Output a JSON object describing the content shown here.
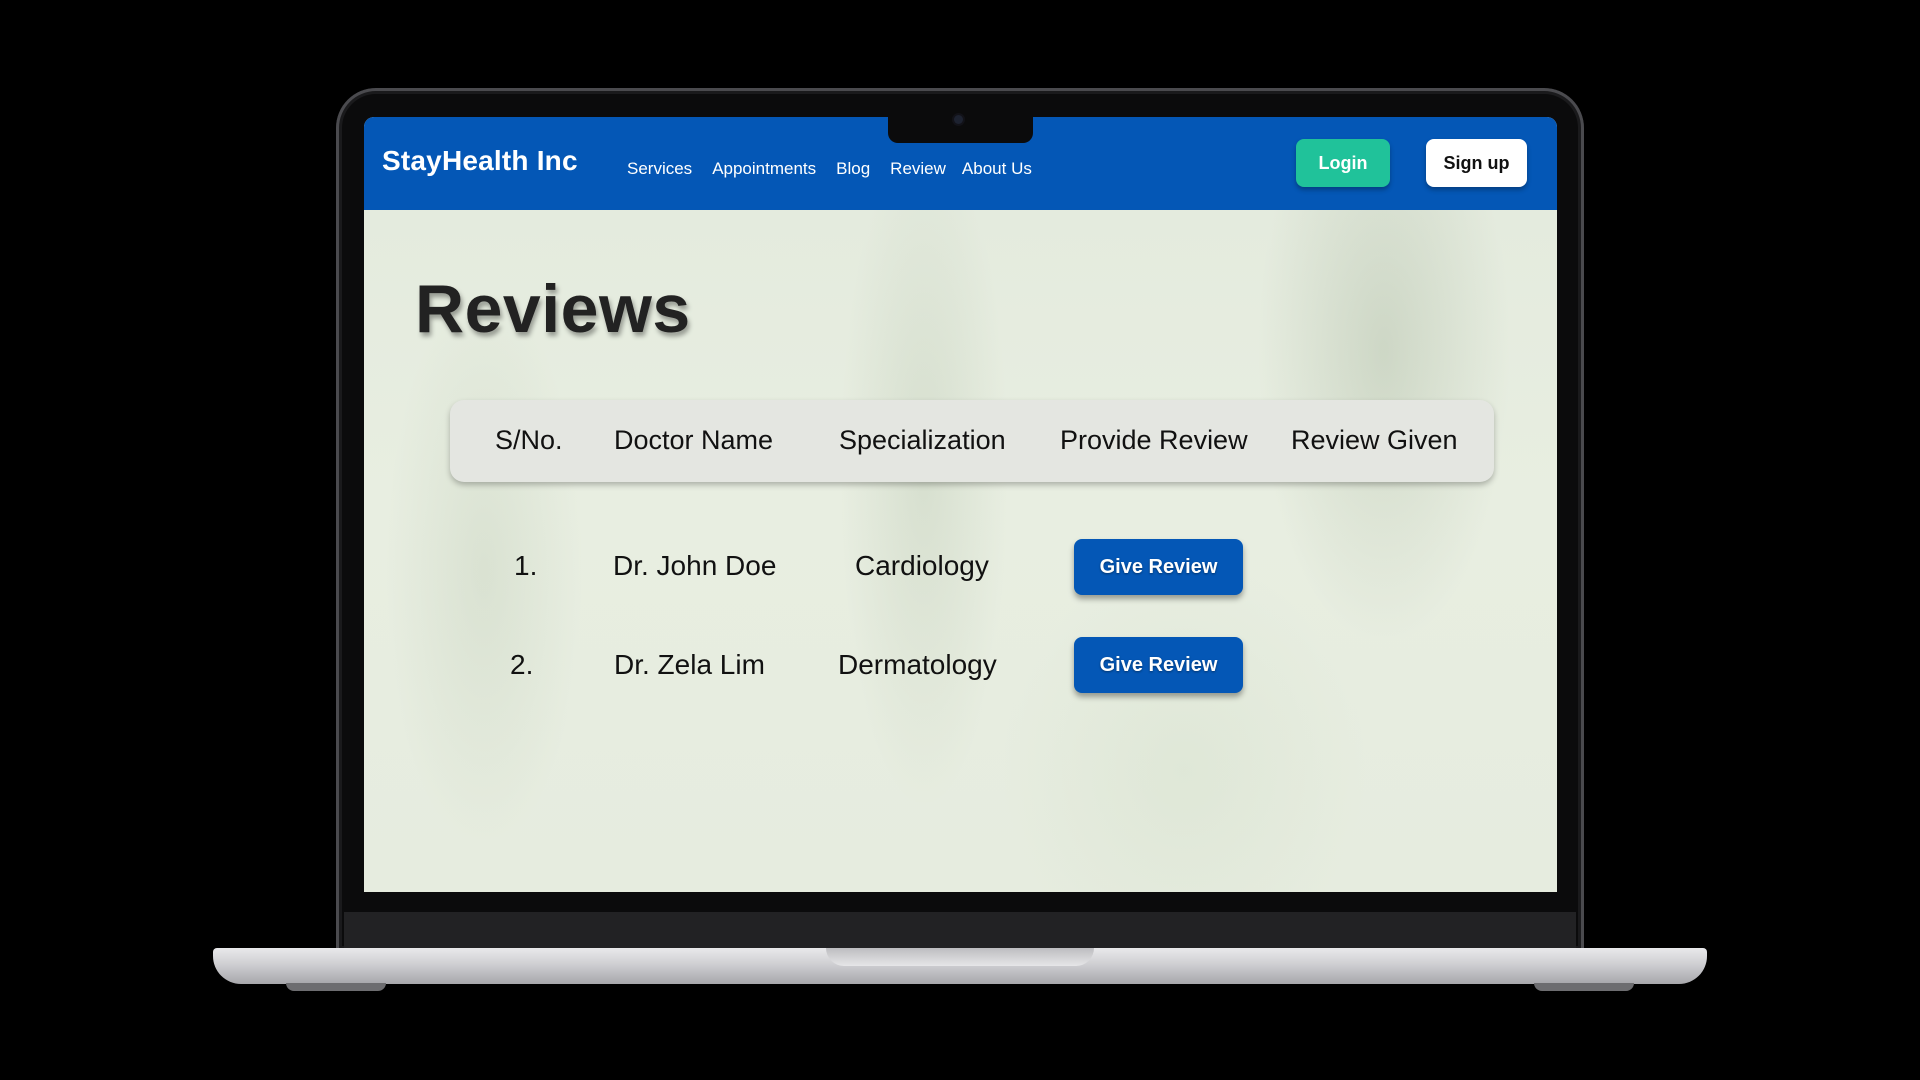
{
  "app": {
    "brand": "StayHealth Inc"
  },
  "nav": {
    "links": [
      "Services",
      "Appointments",
      "Blog",
      "Review",
      "About Us"
    ],
    "login_label": "Login",
    "signup_label": "Sign up"
  },
  "page": {
    "title": "Reviews"
  },
  "table": {
    "headers": [
      "S/No.",
      "Doctor Name",
      "Specialization",
      "Provide Review",
      "Review Given"
    ],
    "rows": [
      {
        "sno": "1.",
        "doctor": "Dr. John Doe",
        "specialization": "Cardiology",
        "action_label": "Give Review",
        "review_given": ""
      },
      {
        "sno": "2.",
        "doctor": "Dr. Zela Lim",
        "specialization": "Dermatology",
        "action_label": "Give Review",
        "review_given": ""
      }
    ]
  },
  "colors": {
    "navbar": "#0457b6",
    "login_button": "#20c29a",
    "review_button": "#0457b6"
  }
}
